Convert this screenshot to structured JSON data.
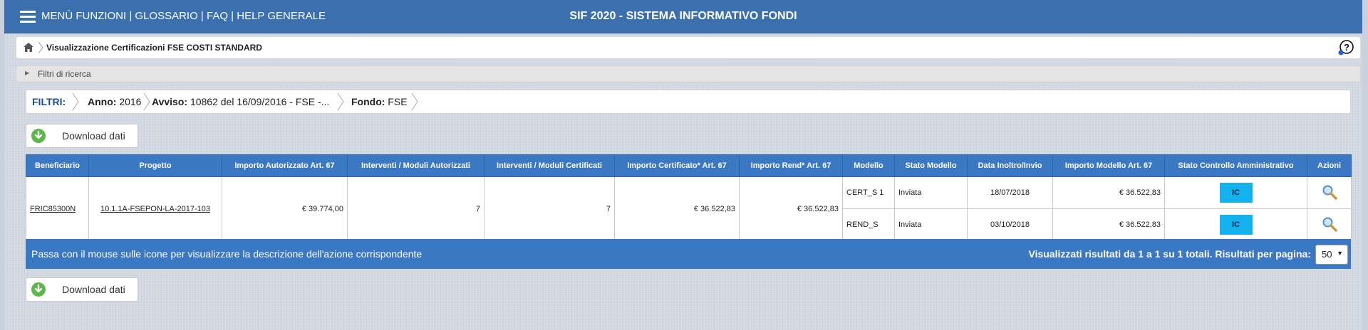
{
  "topbar": {
    "menu_funzioni": "MENÙ FUNZIONI",
    "glossario": "GLOSSARIO",
    "faq": "FAQ",
    "help": "HELP GENERALE",
    "separator": " | ",
    "title": "SIF 2020 - SISTEMA INFORMATIVO FONDI"
  },
  "breadcrumb": {
    "title": "Visualizzazione Certificazioni FSE COSTI STANDARD"
  },
  "filtri_ricerca": {
    "label": "Filtri di ricerca"
  },
  "filters": {
    "label": "FILTRI:",
    "items": [
      {
        "key": "Anno:",
        "value": " 2016"
      },
      {
        "key": "Avviso:",
        "value": " 10862 del 16/09/2016 - FSE -..."
      },
      {
        "key": "Fondo:",
        "value": " FSE"
      }
    ]
  },
  "download": {
    "label": "Download dati"
  },
  "table": {
    "headers": [
      "Beneficiario",
      "Progetto",
      "Importo Autorizzato Art. 67",
      "Interventi / Moduli Autorizzati",
      "Interventi / Moduli Certificati",
      "Importo Certificato* Art. 67",
      "Importo Rend* Art. 67",
      "Modello",
      "Stato Modello",
      "Data Inoltro/Invio",
      "Importo Modello Art. 67",
      "Stato Controllo Amministrativo",
      "Azioni"
    ],
    "row": {
      "beneficiario": "FRIC85300N",
      "progetto": "10.1.1A-FSEPON-LA-2017-103",
      "importo_autorizzato": "€ 39.774,00",
      "moduli_autorizzati": "7",
      "moduli_certificati": "7",
      "importo_certificato": "€ 36.522,83",
      "importo_rend": "€ 36.522,83",
      "models": [
        {
          "modello": "CERT_S 1",
          "stato": "Inviata",
          "data": "18/07/2018",
          "importo": "€ 36.522,83",
          "controllo": "IC",
          "action_icon": "magnifier-icon"
        },
        {
          "modello": "REND_S",
          "stato": "Inviata",
          "data": "03/10/2018",
          "importo": "€ 36.522,83",
          "controllo": "IC",
          "action_icon": "magnifier-icon"
        }
      ]
    }
  },
  "footer": {
    "hint": "Passa con il mouse sulle icone per visualizzare la descrizione dell'azione corrispondente",
    "results": "Visualizzati risultati da 1 a 1 su 1 totali. Risultati per pagina:",
    "per_page": "50"
  },
  "colors": {
    "topbar": "#3a6fb0",
    "table_header": "#3a78c4",
    "badge": "#14b1ef"
  }
}
